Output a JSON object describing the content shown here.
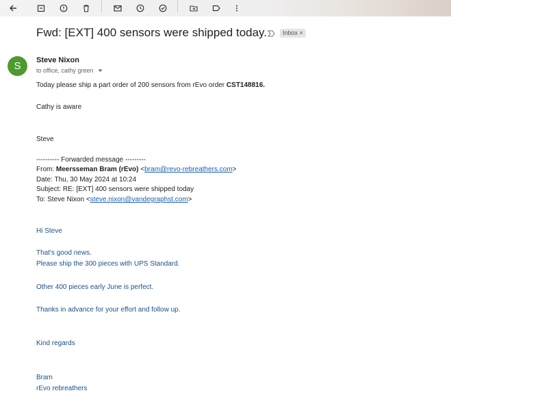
{
  "toolbar": {
    "icons": [
      "back-arrow-icon",
      "archive-icon",
      "report-spam-icon",
      "delete-icon",
      "mark-unread-icon",
      "snooze-icon",
      "add-task-icon",
      "move-to-icon",
      "label-icon",
      "more-icon"
    ]
  },
  "email": {
    "subject": "Fwd: [EXT] 400 sensors were shipped today.",
    "inbox_chip": "Inbox",
    "chip_close": "×",
    "avatar_letter": "S",
    "sender": "Steve Nixon",
    "recipients": "to office, cathy green",
    "body_line1_pre": "Today please ship a part order of 200 sensors from rEvo order ",
    "body_order": "CST148816.",
    "body_line2": "Cathy is aware",
    "signature": "Steve",
    "fwd_header": "---------- Forwarded message ---------",
    "from_label": "From: ",
    "from_name": "Meersseman Bram (rEvo)",
    "from_lt": " <",
    "from_email": "bram@revo-rebreathers.com",
    "from_gt": ">",
    "date_line": "Date: Thu, 30 May 2024 at 10:24",
    "subject_line": "Subject: RE: [EXT] 400 sensors were shipped today",
    "to_label": "To: Steve Nixon <",
    "to_email": "steve.nixon@vandegraphst.com",
    "to_gt": ">",
    "reply": {
      "greeting": "Hi Steve",
      "line1": "That's good news.",
      "line2": "Please ship the 300 pieces with UPS Standard.",
      "line3": "Other 400 pieces early June is perfect.",
      "line4": "Thanks in advance for your effort and follow up.",
      "closing": "Kind regards",
      "name": "Bram",
      "company": "rEvo rebreathers"
    }
  },
  "colors": {
    "avatar": "#4e9a2e",
    "quoted_text": "#1a4f8a",
    "link": "#1a5fb4"
  }
}
